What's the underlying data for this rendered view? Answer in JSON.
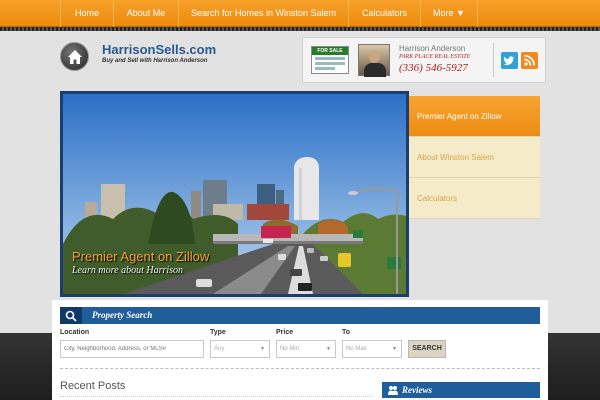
{
  "nav": {
    "items": [
      {
        "label": "Home"
      },
      {
        "label": "About Me"
      },
      {
        "label": "Search for Homes in Winston Salem"
      },
      {
        "label": "Calculators"
      },
      {
        "label": "More ▼"
      }
    ]
  },
  "header": {
    "site_title": "HarrisonSells.com",
    "tagline": "Buy and Sell with Harrison Anderson",
    "sign_text": "FOR SALE",
    "agent_name": "Harrison Anderson",
    "company": "PARK PLACE REAL ESTATE",
    "phone": "(336) 546-5927"
  },
  "hero": {
    "title": "Premier Agent on Zillow",
    "subtitle": "Learn more about Harrison",
    "billboard_text": "",
    "tabs": [
      {
        "label": "Premier Agent on Zillow",
        "active": true
      },
      {
        "label": "About Winston Salem",
        "active": false
      },
      {
        "label": "Calculators",
        "active": false
      }
    ]
  },
  "property_search": {
    "title": "Property Search",
    "location_label": "Location",
    "location_placeholder": "City, Neighborhood, Address, or MLS#",
    "type_label": "Type",
    "type_value": "Any",
    "price_label": "Price",
    "price_min": "No Min",
    "to_label": "To",
    "price_max": "No Max",
    "search_label": "SEARCH"
  },
  "recent_posts": {
    "title": "Recent Posts"
  },
  "reviews": {
    "title": "Reviews"
  },
  "colors": {
    "accent": "#ef8f14",
    "brand_blue": "#1f5e9a",
    "dark_blue": "#1b3e6e"
  }
}
